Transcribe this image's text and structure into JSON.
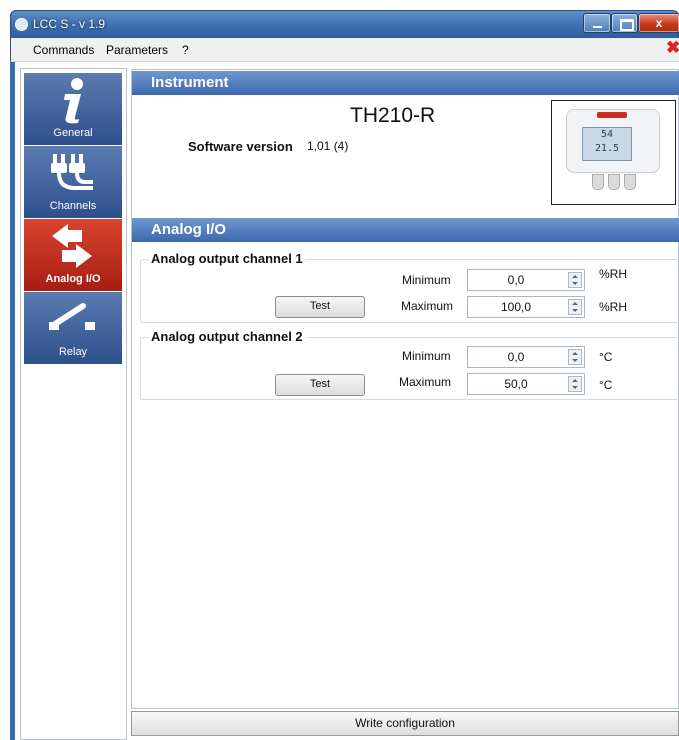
{
  "window": {
    "title": "LCC S - v 1.9",
    "close_glyph": "x"
  },
  "menu": {
    "items": [
      "Commands",
      "Parameters",
      "?"
    ],
    "close_icon": "red-x-icon"
  },
  "sidebar": {
    "items": [
      {
        "label": "General",
        "icon": "info-icon",
        "active": false
      },
      {
        "label": "Channels",
        "icon": "plug-icon",
        "active": false
      },
      {
        "label": "Analog I/O",
        "icon": "arrows-icon",
        "active": true
      },
      {
        "label": "Relay",
        "icon": "switch-icon",
        "active": false
      }
    ],
    "colors": {
      "normal": "#3b5d9a",
      "active": "#c2301f"
    }
  },
  "instrument": {
    "header": "Instrument",
    "model": "TH210-R",
    "software_label": "Software version",
    "software_value": "1,01 (4)",
    "device_display": [
      "54",
      "21.5"
    ]
  },
  "analog": {
    "header": "Analog I/O",
    "channels": [
      {
        "title": "Analog output channel 1",
        "min_label": "Minimum",
        "max_label": "Maximum",
        "min": "0,0",
        "max": "100,0",
        "unit_min": "%RH",
        "unit_max": "%RH",
        "test_label": "Test"
      },
      {
        "title": "Analog output channel 2",
        "min_label": "Minimum",
        "max_label": "Maximum",
        "min": "0,0",
        "max": "50,0",
        "unit_min": "°C",
        "unit_max": "°C",
        "test_label": "Test"
      }
    ]
  },
  "footer": {
    "write_label": "Write configuration"
  }
}
